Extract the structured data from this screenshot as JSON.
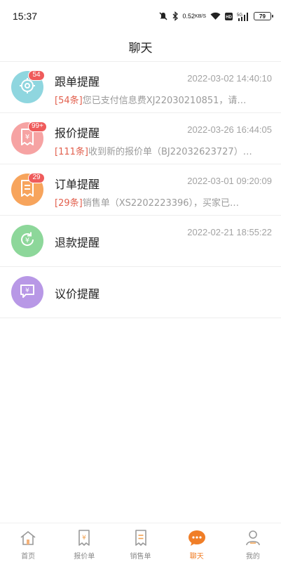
{
  "status_bar": {
    "time": "15:37",
    "net_speed_value": "0.52",
    "net_speed_unit": "KB/S",
    "battery": "79",
    "icons": [
      "mute-icon",
      "bluetooth-icon",
      "wifi-icon",
      "hd-icon",
      "signal-5g-icon",
      "battery-icon"
    ]
  },
  "header": {
    "title": "聊天"
  },
  "chats": [
    {
      "title": "跟单提醒",
      "time": "2022-03-02 14:40:10",
      "badge": "54",
      "count_tag": "[54条]",
      "preview": "您已支付信息费XJ22030210851，请…",
      "icon": "target-icon",
      "color": "#8fd6df"
    },
    {
      "title": "报价提醒",
      "time": "2022-03-26 16:44:05",
      "badge": "99+",
      "count_tag": "[111条]",
      "preview": "收到新的报价单（BJ22032623727）…",
      "icon": "receipt-yen-icon",
      "color": "#f6a3a3"
    },
    {
      "title": "订单提醒",
      "time": "2022-03-01 09:20:09",
      "badge": "29",
      "count_tag": "[29条]",
      "preview": "销售单（XS2202223396），买家已…",
      "icon": "order-document-icon",
      "color": "#f7a45c"
    },
    {
      "title": "退款提醒",
      "time": "2022-02-21 18:55:22",
      "icon": "refund-yen-icon",
      "color": "#8dd79a"
    },
    {
      "title": "议价提醒",
      "icon": "bargain-yen-icon",
      "color": "#b898e6"
    }
  ],
  "tabs": [
    {
      "label": "首页",
      "icon": "home-icon"
    },
    {
      "label": "报价单",
      "icon": "quote-receipt-icon"
    },
    {
      "label": "销售单",
      "icon": "sales-receipt-icon"
    },
    {
      "label": "聊天",
      "icon": "chat-bubble-icon",
      "active": true
    },
    {
      "label": "我的",
      "icon": "profile-icon"
    }
  ],
  "colors": {
    "accent": "#f07e27",
    "badge": "#ef5b5b",
    "count_tag": "#e2604e"
  }
}
